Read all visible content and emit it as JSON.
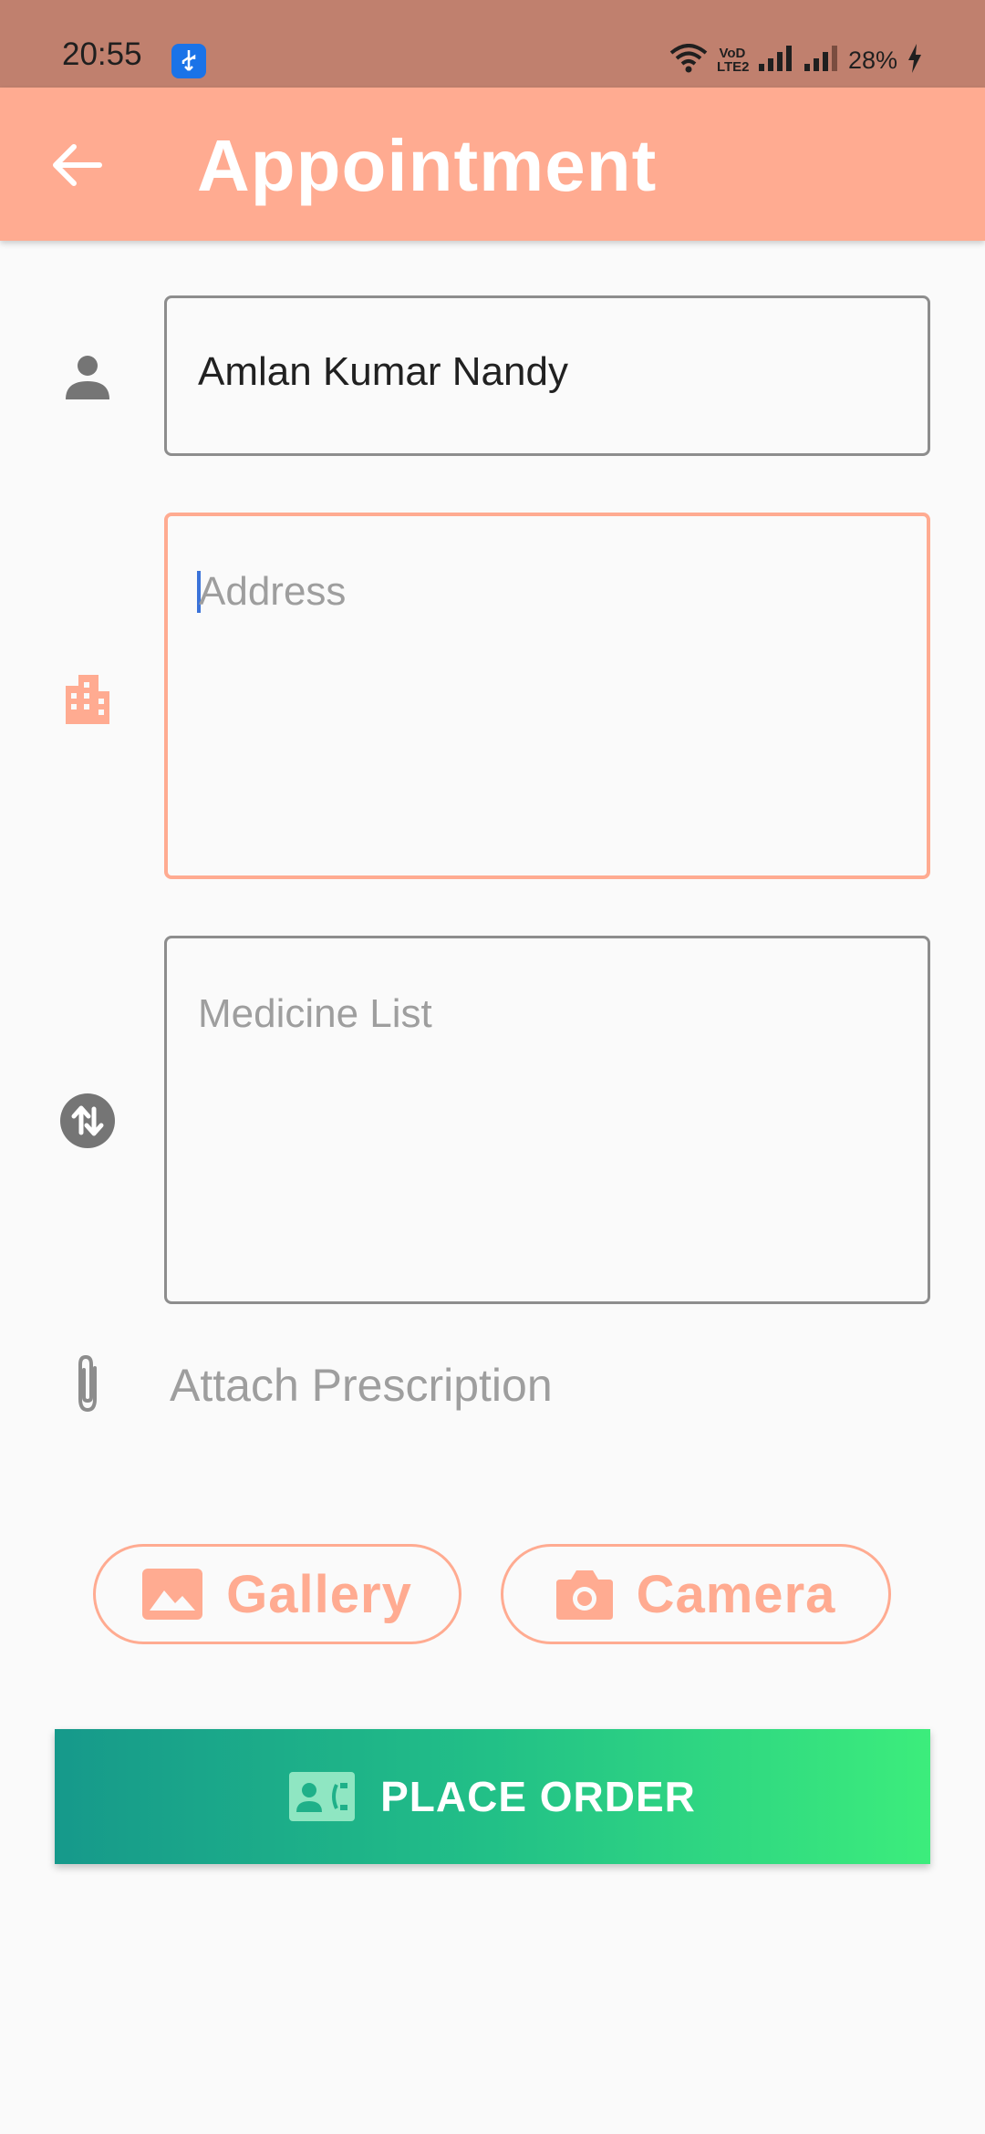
{
  "status_bar": {
    "time": "20:55",
    "network_label": "VoD LTE2",
    "battery": "28%"
  },
  "app_bar": {
    "title": "Appointment",
    "back_icon": "arrow-left-icon"
  },
  "form": {
    "name": {
      "icon": "person-icon",
      "value": "Amlan Kumar Nandy"
    },
    "address": {
      "icon": "building-icon",
      "placeholder": "Address",
      "value": ""
    },
    "medicine": {
      "icon": "swap-vertical-icon",
      "placeholder": "Medicine List",
      "value": ""
    },
    "attach": {
      "icon": "paperclip-icon",
      "label": "Attach Prescription"
    }
  },
  "buttons": {
    "gallery": {
      "icon": "image-icon",
      "label": "Gallery"
    },
    "camera": {
      "icon": "camera-icon",
      "label": "Camera"
    },
    "place_order": {
      "icon": "contact-phone-icon",
      "label": "PLACE ORDER"
    }
  },
  "colors": {
    "accent": "#ffab91",
    "status_bar": "#c0806e",
    "gradient_start": "#16998b",
    "gradient_end": "#3ced7c"
  }
}
